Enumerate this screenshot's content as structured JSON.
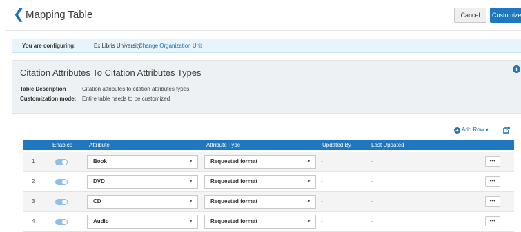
{
  "header": {
    "back_icon": "chevron-left-icon",
    "title": "Mapping Table",
    "cancel_label": "Cancel",
    "customize_label": "Customize"
  },
  "config": {
    "label": "You are configuring:",
    "org": "Ex Libris University",
    "change_link": "Change Organization Unit"
  },
  "info": {
    "title": "Citation Attributes To Citation Attributes Types",
    "table_description_label": "Table Description",
    "table_description_value": "Citation attributes to citation attributes types",
    "customization_mode_label": "Customization mode:",
    "customization_mode_value": "Entire table needs to be customized"
  },
  "toolbar": {
    "add_row_label": "Add Row",
    "export_icon": "external-link-icon"
  },
  "table": {
    "columns": [
      "Enabled",
      "Attribute",
      "Attribute Type",
      "Updated By",
      "Last Updated"
    ],
    "rows": [
      {
        "num": "1",
        "enabled": true,
        "attribute": "Book",
        "type": "Requested format",
        "updated_by": "-",
        "last_updated": "-"
      },
      {
        "num": "2",
        "enabled": true,
        "attribute": "DVD",
        "type": "Requested format",
        "updated_by": "-",
        "last_updated": "-"
      },
      {
        "num": "3",
        "enabled": true,
        "attribute": "CD",
        "type": "Requested format",
        "updated_by": "-",
        "last_updated": "-"
      },
      {
        "num": "4",
        "enabled": true,
        "attribute": "Audio",
        "type": "Requested format",
        "updated_by": "-",
        "last_updated": "-"
      }
    ],
    "more_label": "•••"
  },
  "colors": {
    "accent": "#1f77c0",
    "config_bg": "#e8f4fb",
    "panel_bg": "#eef1f3"
  }
}
